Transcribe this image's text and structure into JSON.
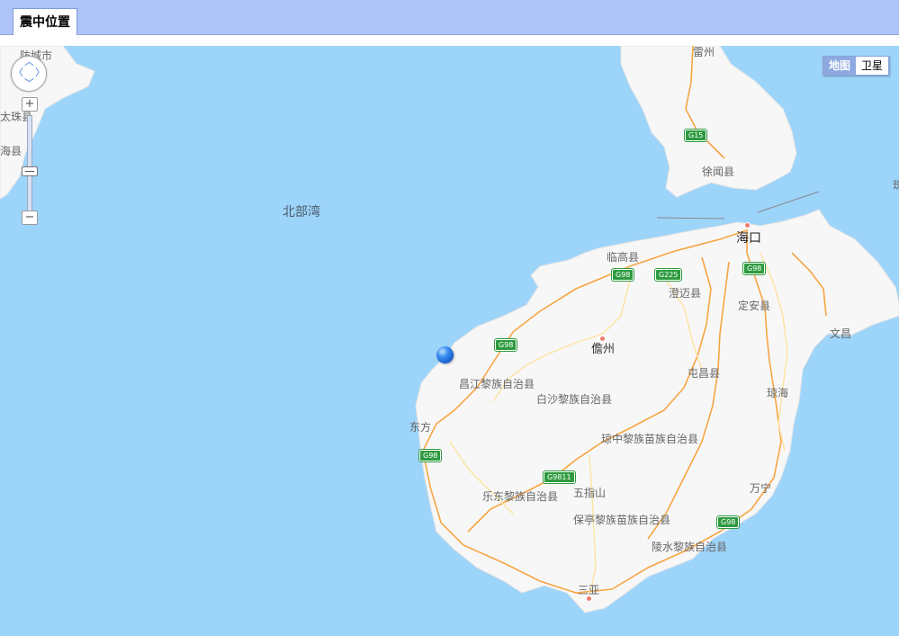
{
  "tab": {
    "label": "震中位置"
  },
  "map_type": {
    "map_label": "地图",
    "satellite_label": "卫星",
    "selected": "地图"
  },
  "zoom": {
    "in_label": "+",
    "out_label": "−"
  },
  "sea": {
    "name": "北部湾"
  },
  "places": {
    "haikou": "海口",
    "danzhou": "儋州",
    "lingao": "临高县",
    "chengmai": "澄迈县",
    "dingan": "定安县",
    "wenchang": "文昌",
    "tunchang": "屯昌县",
    "qionghai": "琼海",
    "changjiang": "昌江黎族自治县",
    "baisha": "白沙黎族自治县",
    "dongfang": "东方",
    "qiongzhong": "琼中黎族苗族自治县",
    "wuzhishan": "五指山",
    "ledong": "乐东黎族自治县",
    "baoting": "保亭黎族苗族自治县",
    "wanning": "万宁",
    "lingshui": "陵水黎族自治县",
    "sanya": "三亚",
    "xuwen": "徐闻县",
    "top_center": "雷州",
    "top_left": "防城市",
    "left_mid": "太珠县",
    "left_low": "海县",
    "right_edge": "珠"
  },
  "highways": {
    "g15": "G15",
    "g98_n1": "G98",
    "g225": "G225",
    "g98_ne": "G98",
    "g98_w1": "G98",
    "g98_w2": "G98",
    "g9811": "G9811",
    "g98_se": "G98"
  }
}
